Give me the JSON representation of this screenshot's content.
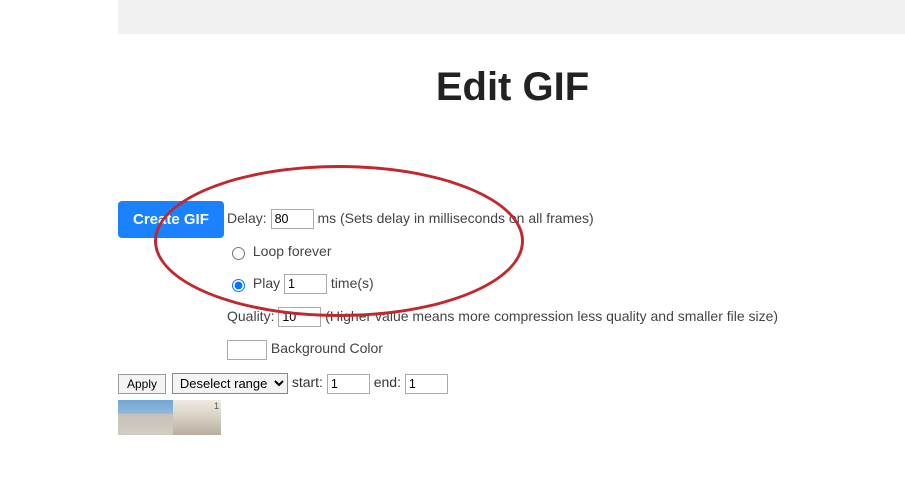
{
  "header": {
    "title": "Edit GIF"
  },
  "button": {
    "create": "Create GIF"
  },
  "options": {
    "delay_label": "Delay:",
    "delay_value": "80",
    "delay_suffix": "ms (Sets delay in milliseconds on all frames)",
    "loop_forever_label": "Loop forever",
    "play_prefix": "Play",
    "play_value": "1",
    "play_suffix": "time(s)",
    "quality_label": "Quality:",
    "quality_value": "10",
    "quality_suffix": "(Higher value means more compression less quality and smaller file size)",
    "bg_color_label": "Background Color"
  },
  "range": {
    "apply_label": "Apply",
    "action_label": "Deselect range",
    "start_label": "start:",
    "start_value": "1",
    "end_label": "end:",
    "end_value": "1"
  },
  "thumbs": {
    "frame2_badge": "1"
  }
}
